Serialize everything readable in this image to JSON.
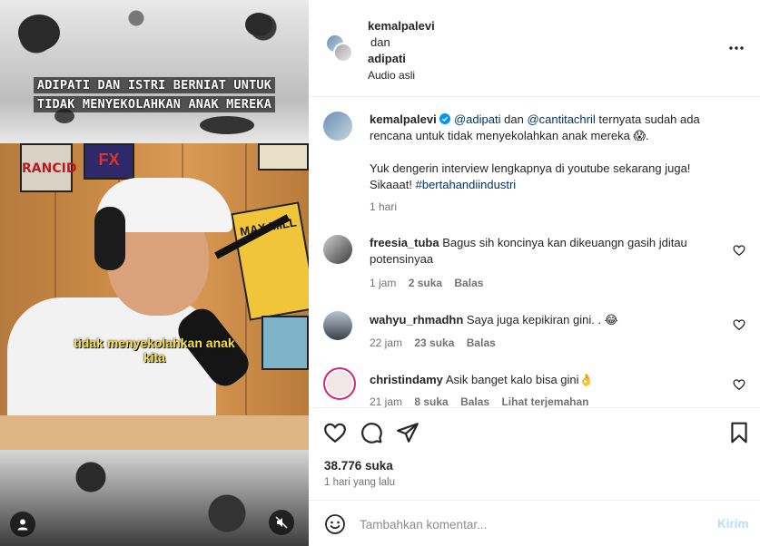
{
  "media": {
    "headline_line1": "ADIPATI DAN ISTRI BERNIAT UNTUK",
    "headline_line2": "TIDAK MENYEKOLAHKAN ANAK MEREKA",
    "subtitle_line1": "tidak menyekolahkan anak",
    "subtitle_line2": "kita",
    "poster_1": "RANCID",
    "poster_2": "FX",
    "poster_3": "MAX MILL",
    "user_icon": "user-icon",
    "mute_icon": "muted-speaker-icon"
  },
  "header": {
    "author": "kemalpalevi",
    "conjunction": "dan",
    "coauthor": "adipati",
    "audio": "Audio asli",
    "more_icon": "more-dots-icon"
  },
  "caption": {
    "username": "kemalpalevi",
    "verified_icon": "verified-badge-icon",
    "mention_1": "@adipati",
    "text_dan": "dan",
    "mention_2": "@cantitachril",
    "text_1": "ternyata sudah ada rencana untuk tidak menyekolahkan anak mereka 😱.",
    "text_2": "Yuk dengerin interview lengkapnya di youtube sekarang juga! Sikaaat!",
    "hashtag": "#bertahandiindustri",
    "time": "1 hari"
  },
  "comments": [
    {
      "username": "freesia_tuba",
      "text": "Bagus sih koncinya kan dikeuangn gasih jditau potensinyaa",
      "time": "1 jam",
      "likes": "2 suka",
      "reply": "Balas",
      "translate": ""
    },
    {
      "username": "wahyu_rhmadhn",
      "text": "Saya juga kepikiran gini. . 😂",
      "time": "22 jam",
      "likes": "23 suka",
      "reply": "Balas",
      "translate": ""
    },
    {
      "username": "christindamy",
      "text": "Asik banget kalo bisa gini👌",
      "time": "21 jam",
      "likes": "8 suka",
      "reply": "Balas",
      "translate": "Lihat terjemahan"
    }
  ],
  "actions": {
    "like_icon": "heart-icon",
    "comment_icon": "comment-bubble-icon",
    "share_icon": "paper-plane-icon",
    "save_icon": "bookmark-icon",
    "likes_count": "38.776 suka",
    "posted": "1 hari yang lalu"
  },
  "add_comment": {
    "emoji_icon": "emoji-smile-icon",
    "placeholder": "Tambahkan komentar...",
    "submit": "Kirim"
  },
  "colors": {
    "link": "#00376b",
    "submit_disabled": "#b2dffc",
    "verified": "#0095f6",
    "subtitle": "#f7e14a"
  }
}
